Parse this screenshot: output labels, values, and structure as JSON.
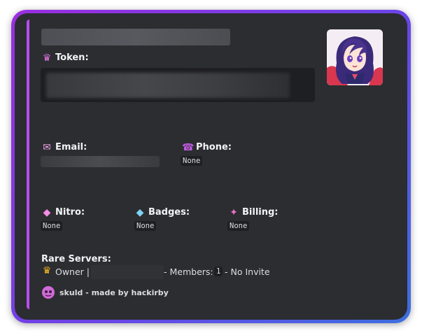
{
  "embed": {
    "accent_color": "#b74df0",
    "token_label": "Token:",
    "token_icon": "crown-icon",
    "email_label": "Email:",
    "email_icon": "envelope-icon",
    "phone_label": "Phone:",
    "phone_icon": "phone-icon",
    "phone_value": "None",
    "nitro_label": "Nitro:",
    "nitro_icon": "nitro-gem-icon",
    "nitro_value": "None",
    "badges_label": "Badges:",
    "badges_icon": "diamond-icon",
    "badges_value": "None",
    "billing_label": "Billing:",
    "billing_icon": "sparkles-icon",
    "billing_value": "None",
    "rare_servers_label": "Rare Servers:",
    "rare_server": {
      "icon": "crown-gold-icon",
      "owner_text": "Owner |",
      "members_label": "- Members:",
      "members_count": "1",
      "invite_text": "- No Invite"
    },
    "footer": {
      "icon": "skuld-avatar-icon",
      "text": "skuld - made by hackirby"
    }
  },
  "colors": {
    "frame_gradient_start": "#9b2fe0",
    "frame_gradient_end": "#3d6fe0",
    "background": "#2b2d31"
  }
}
